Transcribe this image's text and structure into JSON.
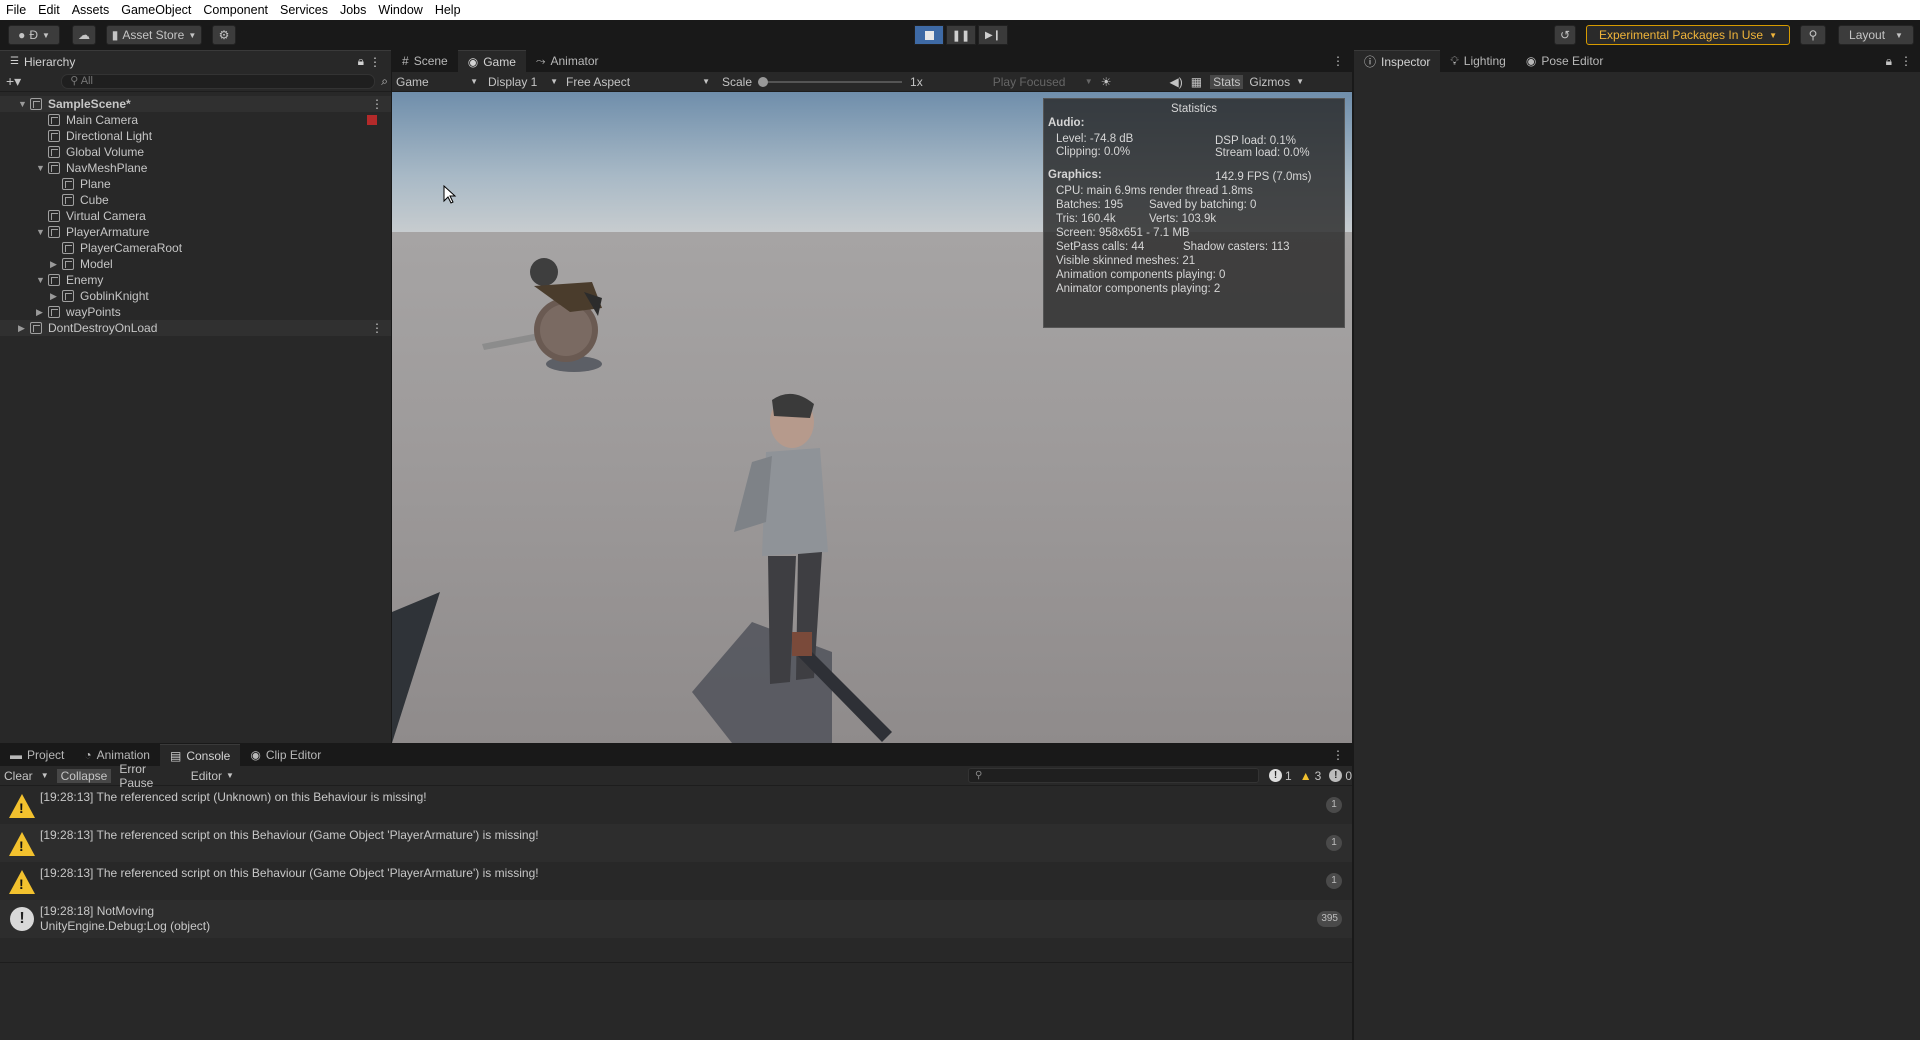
{
  "menubar": [
    "File",
    "Edit",
    "Assets",
    "GameObject",
    "Component",
    "Services",
    "Jobs",
    "Window",
    "Help"
  ],
  "toolbar": {
    "account": "Ð",
    "asset_store": "Asset Store",
    "experimental": "Experimental Packages In Use",
    "layout": "Layout"
  },
  "hierarchy": {
    "tab": "Hierarchy",
    "search_placeholder": "All",
    "items": [
      {
        "label": "SampleScene*",
        "depth": 0,
        "bold": true
      },
      {
        "label": "Main Camera",
        "depth": 1
      },
      {
        "label": "Directional Light",
        "depth": 1
      },
      {
        "label": "Global Volume",
        "depth": 1
      },
      {
        "label": "NavMeshPlane",
        "depth": 1
      },
      {
        "label": "Plane",
        "depth": 2
      },
      {
        "label": "Cube",
        "depth": 2
      },
      {
        "label": "Virtual Camera",
        "depth": 1
      },
      {
        "label": "PlayerArmature",
        "depth": 1
      },
      {
        "label": "PlayerCameraRoot",
        "depth": 2
      },
      {
        "label": "Model",
        "depth": 2
      },
      {
        "label": "Enemy",
        "depth": 1
      },
      {
        "label": "GoblinKnight",
        "depth": 2
      },
      {
        "label": "wayPoints",
        "depth": 1
      },
      {
        "label": "DontDestroyOnLoad",
        "depth": 0
      }
    ]
  },
  "game": {
    "tabs": [
      "Scene",
      "Game",
      "Animator"
    ],
    "mode": "Game",
    "display": "Display 1",
    "aspect": "Free Aspect",
    "scale_label": "Scale",
    "scale_value": "1x",
    "play_focused": "Play Focused",
    "stats": "Stats",
    "gizmos": "Gizmos"
  },
  "statistics": {
    "title": "Statistics",
    "audio_label": "Audio:",
    "level": "Level: -74.8 dB",
    "clipping": "Clipping: 0.0%",
    "dsp": "DSP load: 0.1%",
    "stream": "Stream load: 0.0%",
    "graphics_label": "Graphics:",
    "fps": "142.9 FPS (7.0ms)",
    "cpu": "CPU: main 6.9ms  render thread 1.8ms",
    "batches": "Batches: 195",
    "saved": "Saved by batching: 0",
    "tris": "Tris: 160.4k",
    "verts": "Verts: 103.9k",
    "screen": "Screen: 958x651 - 7.1 MB",
    "setpass": "SetPass calls: 44",
    "shadow": "Shadow casters: 113",
    "skinned": "Visible skinned meshes: 21",
    "anim": "Animation components playing: 0",
    "animator": "Animator components playing: 2"
  },
  "inspector": {
    "tabs": [
      "Inspector",
      "Lighting",
      "Pose Editor"
    ]
  },
  "console": {
    "tabs": [
      "Project",
      "Animation",
      "Console",
      "Clip Editor"
    ],
    "clear": "Clear",
    "collapse": "Collapse",
    "error_pause": "Error Pause",
    "editor": "Editor",
    "count_info": "1",
    "count_warn": "3",
    "count_error": "0",
    "logs": [
      {
        "type": "warning",
        "text": "[19:28:13] The referenced script (Unknown) on this Behaviour is missing!",
        "count": "1"
      },
      {
        "type": "warning",
        "text": "[19:28:13] The referenced script on this Behaviour (Game Object 'PlayerArmature') is missing!",
        "count": "1"
      },
      {
        "type": "warning",
        "text": "[19:28:13] The referenced script on this Behaviour (Game Object 'PlayerArmature') is missing!",
        "count": "1"
      },
      {
        "type": "info",
        "text": "[19:28:18] NotMoving",
        "text2": "UnityEngine.Debug:Log (object)",
        "count": "395"
      }
    ]
  },
  "colors": {
    "accent": "#3e6aa5",
    "warning": "#f2c12e",
    "experimental_border": "#d79b00"
  }
}
